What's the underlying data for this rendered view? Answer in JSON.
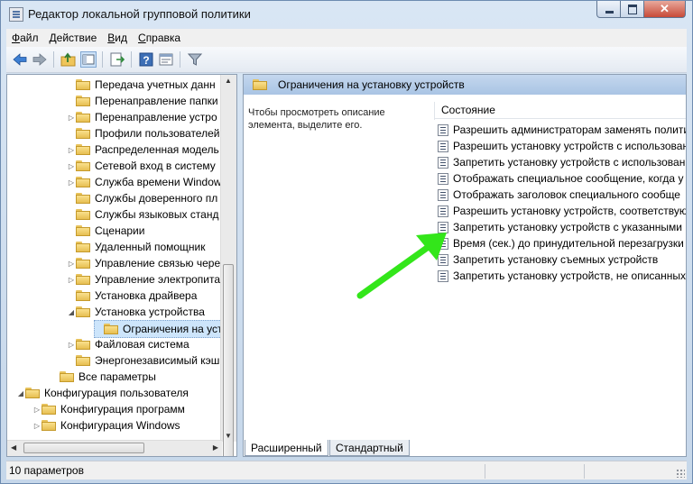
{
  "window": {
    "title": "Редактор локальной групповой политики",
    "close_glyph": "✕"
  },
  "menu": [
    {
      "first": "Ф",
      "rest": "айл"
    },
    {
      "first": "Д",
      "rest": "ействие"
    },
    {
      "first": "В",
      "rest": "ид"
    },
    {
      "first": "С",
      "rest": "правка"
    }
  ],
  "tree": {
    "items": [
      {
        "label": "Передача учетных данн",
        "expander": ""
      },
      {
        "label": "Перенаправление папки",
        "expander": ""
      },
      {
        "label": "Перенаправление устро",
        "expander": "▷"
      },
      {
        "label": "Профили пользователей",
        "expander": ""
      },
      {
        "label": "Распределенная модель",
        "expander": "▷"
      },
      {
        "label": "Сетевой вход в систему",
        "expander": "▷"
      },
      {
        "label": "Служба времени Window",
        "expander": "▷"
      },
      {
        "label": "Службы доверенного пл",
        "expander": ""
      },
      {
        "label": "Службы языковых станд",
        "expander": ""
      },
      {
        "label": "Сценарии",
        "expander": ""
      },
      {
        "label": "Удаленный помощник",
        "expander": ""
      },
      {
        "label": "Управление связью чере",
        "expander": "▷"
      },
      {
        "label": "Управление электропита",
        "expander": "▷"
      },
      {
        "label": "Установка драйвера",
        "expander": ""
      },
      {
        "label": "Установка устройства",
        "expander": "◢"
      },
      {
        "label": "Ограничения на уста",
        "expander": ""
      },
      {
        "label": "Файловая система",
        "expander": "▷"
      },
      {
        "label": "Энергонезависимый кэш",
        "expander": ""
      },
      {
        "label": "Все параметры",
        "expander": ""
      },
      {
        "label": "Конфигурация пользователя",
        "expander": "◢"
      },
      {
        "label": "Конфигурация программ",
        "expander": "▷"
      },
      {
        "label": "Конфигурация Windows",
        "expander": "▷"
      }
    ]
  },
  "panel": {
    "header": "Ограничения на установку устройств",
    "description": "Чтобы просмотреть описание элемента, выделите его.",
    "column": "Состояние",
    "policies": [
      "Разрешить администраторам заменять полити",
      "Разрешить установку устройств с использован",
      "Запретить установку устройств с использован",
      "Отображать специальное сообщение, когда у",
      "Отображать заголовок специального сообще",
      "Разрешить установку устройств, соответствую",
      "Запретить установку устройств с указанными",
      "Время (сек.) до принудительной перезагрузки",
      "Запретить установку съемных устройств",
      "Запретить установку устройств, не описанных"
    ]
  },
  "tabs": {
    "extended": "Расширенный",
    "standard": "Стандартный"
  },
  "status": {
    "text": "10 параметров"
  },
  "colors": {
    "arrow": "#33e61a",
    "header_bg": "#b8cfea",
    "selection": "#cde5fb"
  }
}
